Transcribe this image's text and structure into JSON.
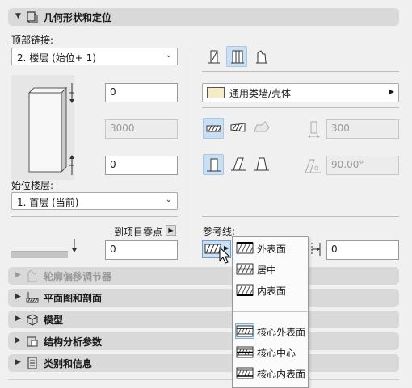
{
  "header": {
    "title": "几何形状和定位"
  },
  "left": {
    "top_link_label": "顶部链接:",
    "top_link_value": "2. 楼层 (始位+ 1)",
    "height_top_value": "0",
    "height_value": "3000",
    "bottom_offset_value": "0",
    "home_story_label": "始位楼层:",
    "home_story_value": "1. 首层 (当前)",
    "project_zero_label": "到项目零点",
    "project_zero_value": "0"
  },
  "right": {
    "building_material": "通用类墙/壳体",
    "thickness_value": "300",
    "angle_value": "90.00°",
    "ref_line_label": "参考线:",
    "ref_offset_value": "0"
  },
  "dropdown_menu": {
    "items": [
      "外表面",
      "居中",
      "内表面",
      "核心外表面",
      "核心中心",
      "核心内表面"
    ]
  },
  "sections": [
    {
      "title": "轮廓偏移调节器",
      "disabled": true
    },
    {
      "title": "平面图和剖面",
      "disabled": false
    },
    {
      "title": "模型",
      "disabled": false
    },
    {
      "title": "结构分析参数",
      "disabled": false
    },
    {
      "title": "类别和信息",
      "disabled": false
    }
  ],
  "colors": {
    "section_bar": "#d9d9d9",
    "selected": "#c9dff3",
    "panel": "#f0f0f0"
  }
}
